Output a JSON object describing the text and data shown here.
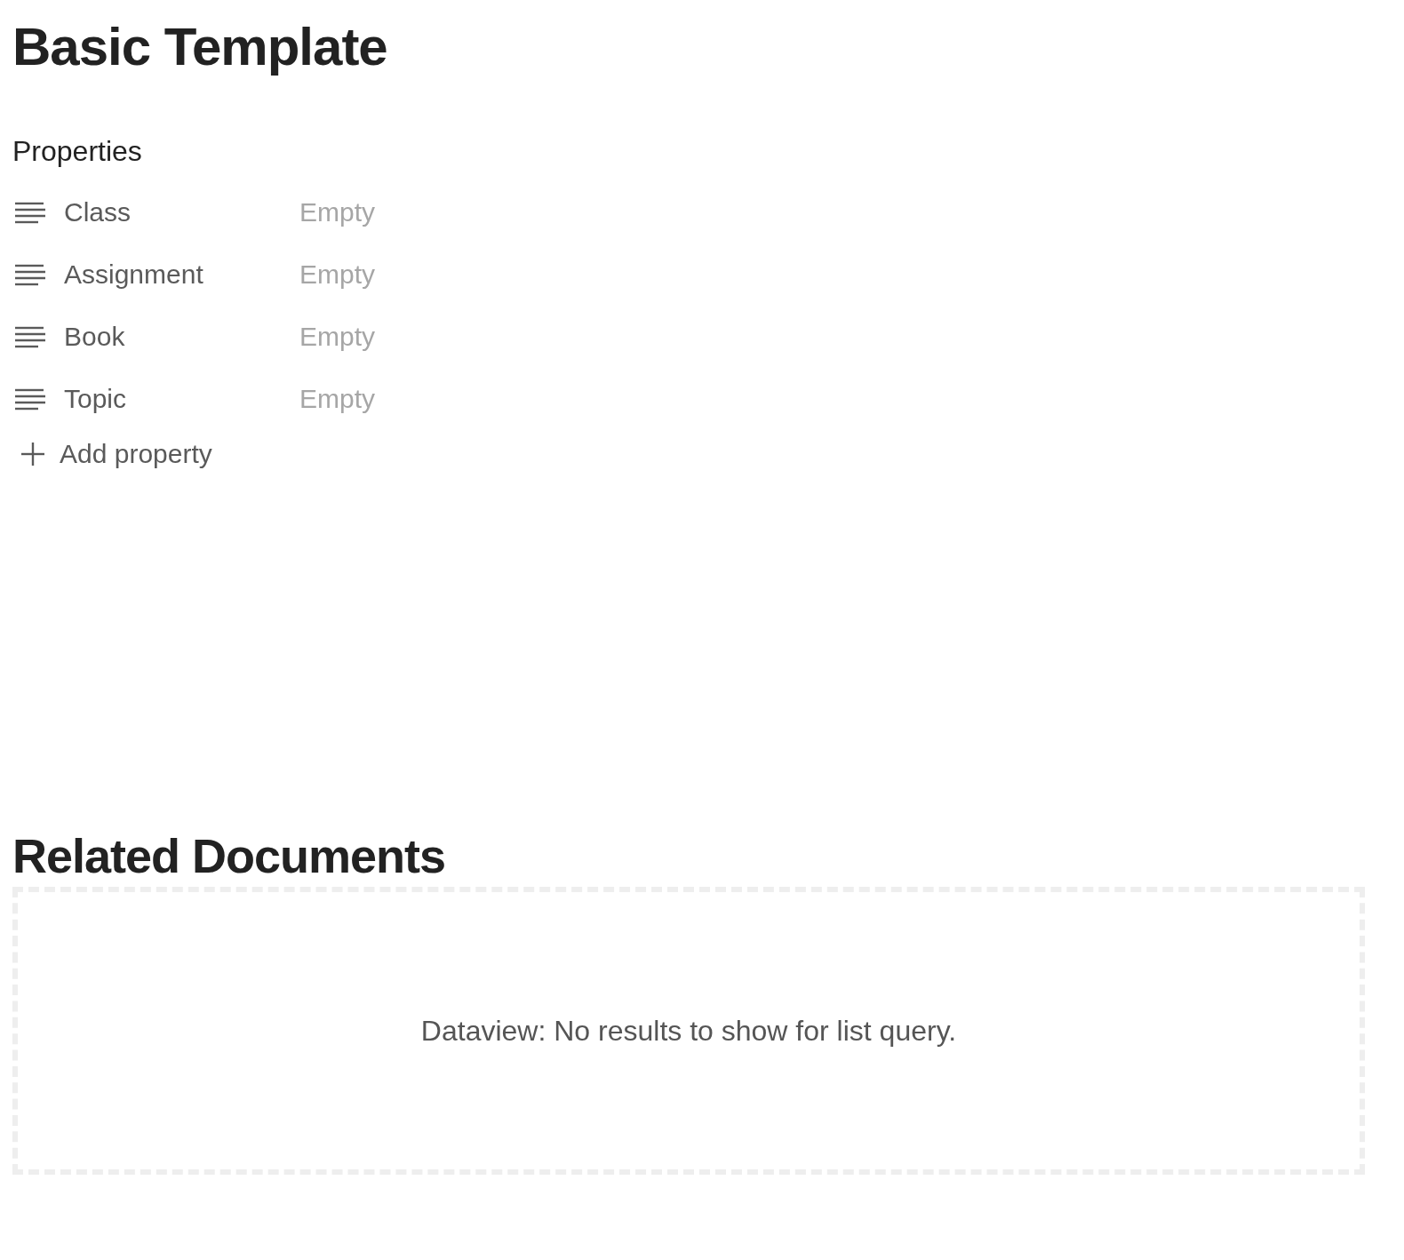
{
  "title": "Basic Template",
  "properties_heading": "Properties",
  "properties": [
    {
      "label": "Class",
      "value": "Empty"
    },
    {
      "label": "Assignment",
      "value": "Empty"
    },
    {
      "label": "Book",
      "value": "Empty"
    },
    {
      "label": "Topic",
      "value": "Empty"
    }
  ],
  "add_property": "Add property",
  "related": {
    "heading": "Related Documents",
    "message": "Dataview: No results to show for list query."
  }
}
